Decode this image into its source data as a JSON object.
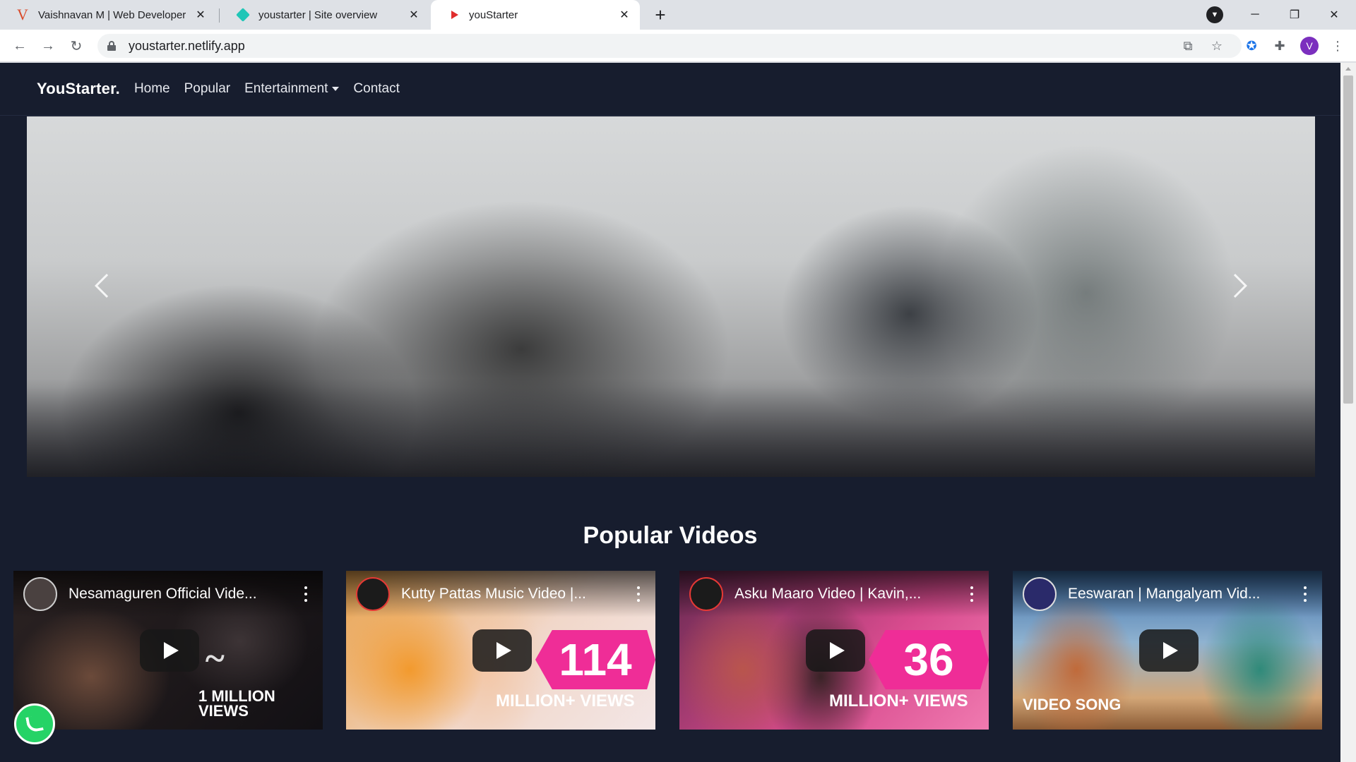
{
  "browser": {
    "tabs": [
      {
        "title": "Vaishnavan M | Web Developer",
        "favicon": "letter-v-icon"
      },
      {
        "title": "youstarter | Site overview",
        "favicon": "netlify-icon"
      },
      {
        "title": "youStarter",
        "favicon": "play-icon",
        "active": true
      }
    ],
    "url": "youstarter.netlify.app",
    "profile_initial": "V"
  },
  "site": {
    "brand": "YouStarter.",
    "nav": {
      "home": "Home",
      "popular": "Popular",
      "entertainment": "Entertainment",
      "contact": "Contact"
    },
    "section_title": "Popular Videos"
  },
  "videos": [
    {
      "title": "Nesamaguren Official Vide...",
      "overlay_text": "1 MILLION VIEWS"
    },
    {
      "title": "Kutty Pattas Music Video |...",
      "overlay_number": "114",
      "overlay_text": "MILLION+ VIEWS"
    },
    {
      "title": "Asku Maaro Video | Kavin,...",
      "overlay_number": "36",
      "overlay_text": "MILLION+ VIEWS"
    },
    {
      "title": "Eeswaran | Mangalyam Vid...",
      "overlay_text": "VIDEO SONG"
    }
  ],
  "colors": {
    "page_bg": "#171d2e",
    "accent_pink": "#ef2d97",
    "whatsapp_green": "#25d366"
  }
}
